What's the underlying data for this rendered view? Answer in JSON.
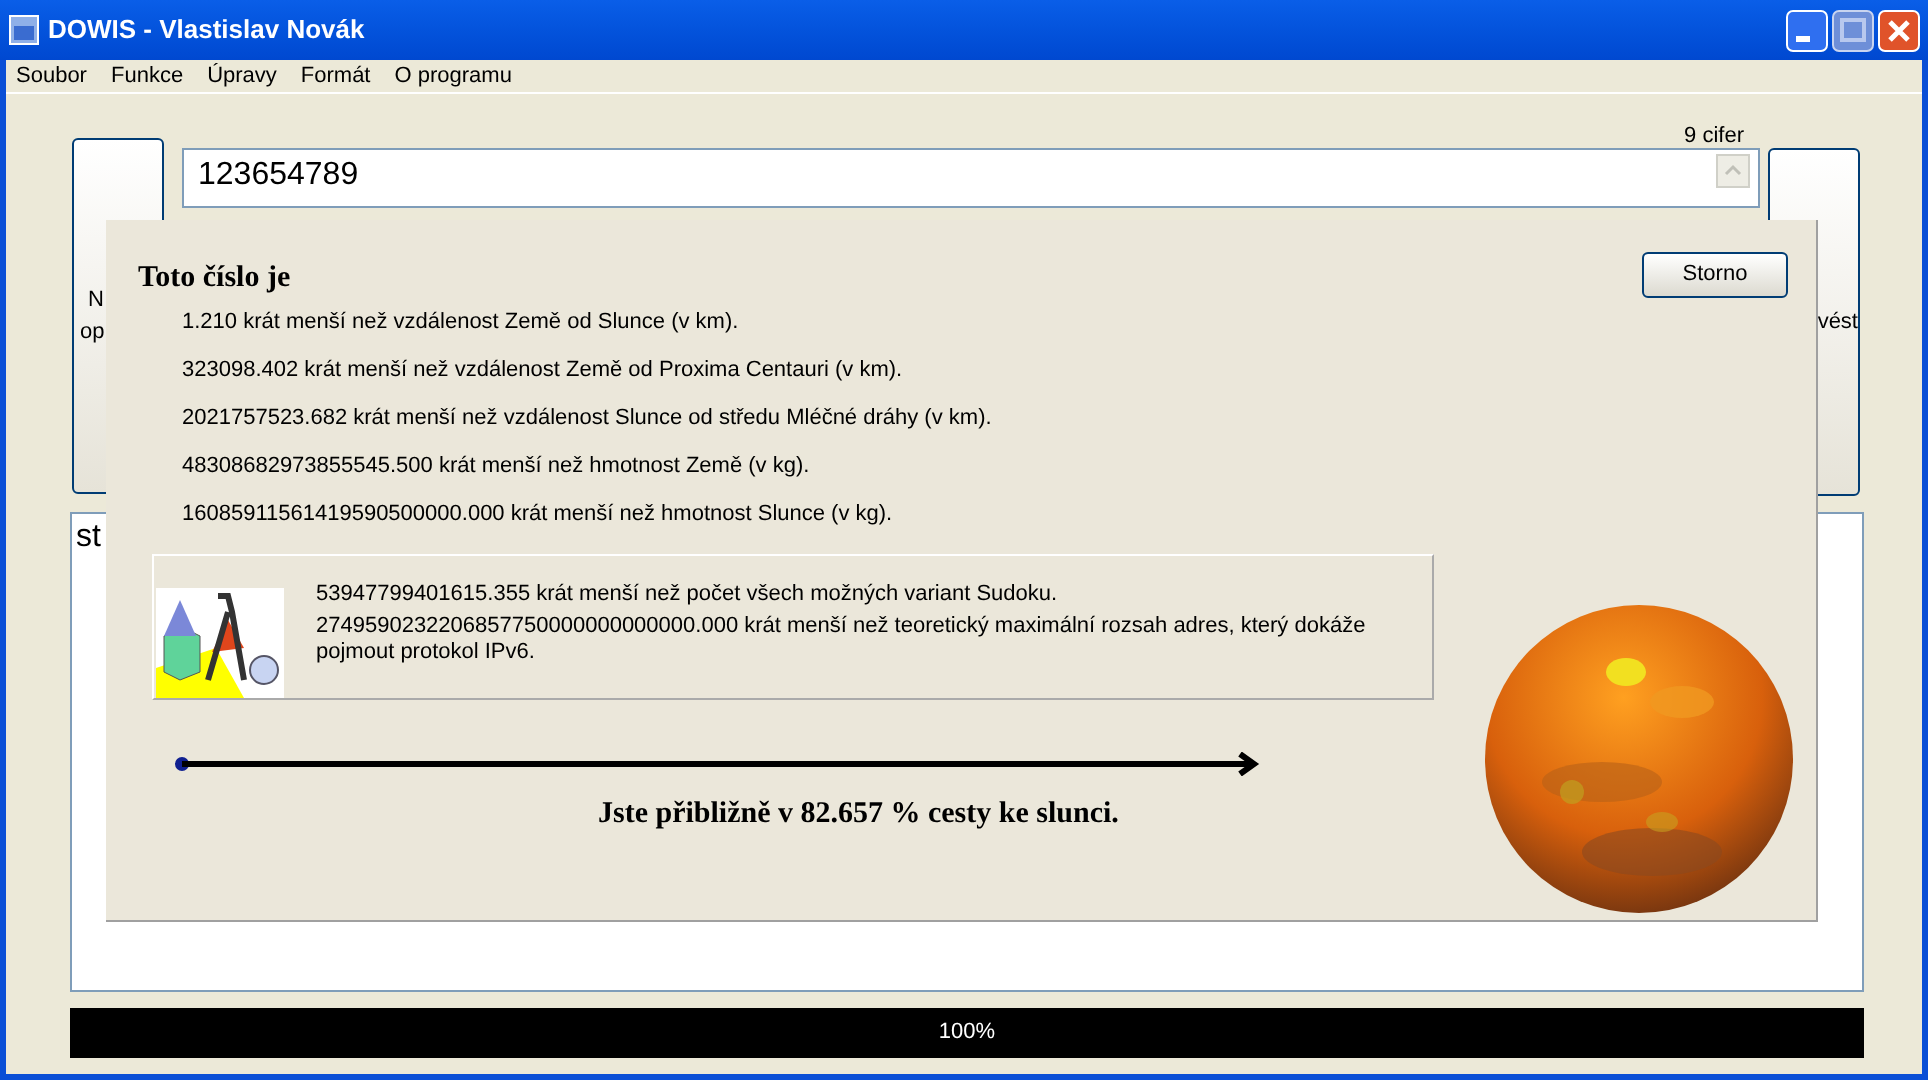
{
  "window": {
    "title": "DOWIS - Vlastislav Novák"
  },
  "menu": [
    "Soubor",
    "Funkce",
    "Úpravy",
    "Formát",
    "O programu"
  ],
  "digit_count": "9 cifer",
  "number_input": {
    "value": "123654789"
  },
  "left_button": {
    "label_lines": [
      "N",
      "op"
    ]
  },
  "right_button": {
    "label": "vést"
  },
  "output_text": "st",
  "progress": {
    "level": 1,
    "label": "100%"
  },
  "dialog": {
    "heading": "Toto číslo je",
    "cancel_button": "Storno",
    "comparisons": [
      "1.210 krát menší než vzdálenost Země od Slunce (v km).",
      "323098.402 krát menší než vzdálenost Země od Proxima Centauri (v km).",
      "2021757523.682 krát menší než vzdálenost Slunce od středu Mléčné dráhy (v km).",
      "48308682973855545.500 krát menší než hmotnost Země (v kg).",
      "16085911561419590500000.000 krát menší než hmotnost Slunce (v kg)."
    ],
    "fun_facts": [
      "53947799401615.355 krát menší než počet všech možných variant Sudoku.",
      "2749590232206857750000000000000.000 krát menší než teoretický maximální rozsah adres, který dokáže pojmout protokol IPv6."
    ],
    "journey_text": "Jste přibližně v 82.657 % cesty ke slunci."
  }
}
